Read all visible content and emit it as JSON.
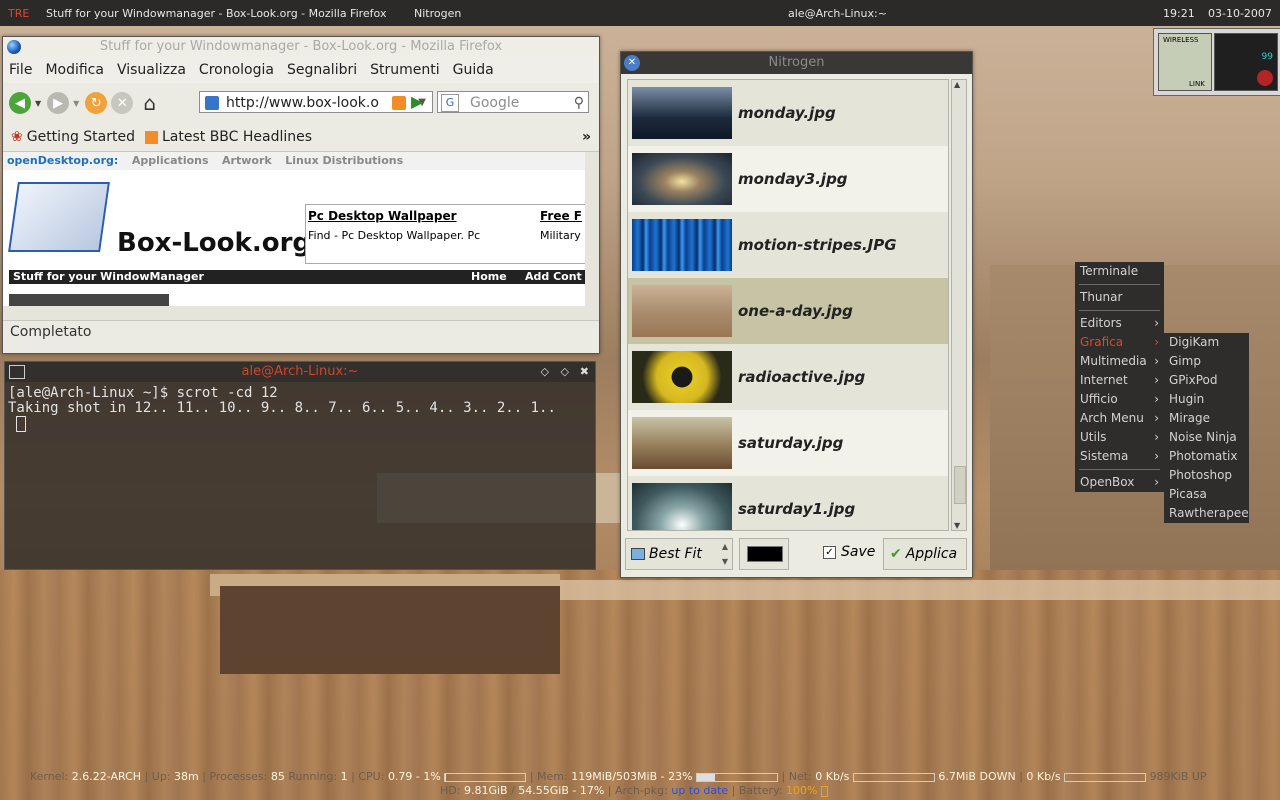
{
  "top_panel": {
    "left_label": "TRE",
    "tasks": [
      "Stuff for your Windowmanager - Box-Look.org - Mozilla Firefox",
      "Nitrogen"
    ],
    "center": "ale@Arch-Linux:~",
    "time": "19:21",
    "date": "03-10-2007"
  },
  "firefox": {
    "title": "Stuff for your Windowmanager - Box-Look.org - Mozilla Firefox",
    "menu": [
      "File",
      "Modifica",
      "Visualizza",
      "Cronologia",
      "Segnalibri",
      "Strumenti",
      "Guida"
    ],
    "url": "http://www.box-look.o",
    "search_placeholder": "Google",
    "bookmarks": [
      "Getting Started",
      "Latest BBC Headlines"
    ],
    "page": {
      "od_logo": "openDesktop.org:",
      "od_nav": [
        "Applications",
        "Artwork",
        "Linux Distributions"
      ],
      "site_name": "Box-Look.org",
      "ad_title": "Pc Desktop Wallpaper",
      "ad_text": "Find - Pc Desktop Wallpaper. Pc",
      "ad2_title": "Free F",
      "ad2_text": "Military",
      "tagline": "Stuff for your WindowManager",
      "nav_links": [
        "Home",
        "Add Cont"
      ]
    },
    "status": "Completato"
  },
  "terminal": {
    "title": "ale@Arch-Linux:~",
    "lines": [
      "[ale@Arch-Linux ~]$ scrot -cd 12",
      "Taking shot in 12.. 11.. 10.. 9.. 8.. 7.. 6.. 5.. 4.. 3.. 2.. 1.."
    ]
  },
  "nitrogen": {
    "title": "Nitrogen",
    "files": [
      "monday.jpg",
      "monday3.jpg",
      "motion-stripes.JPG",
      "one-a-day.jpg",
      "radioactive.jpg",
      "saturday.jpg",
      "saturday1.jpg"
    ],
    "selected_index": 3,
    "mode": "Best Fit",
    "save_label": "Save",
    "apply_label": "Applica",
    "bg_color": "#000000"
  },
  "openbox_menu": {
    "items": [
      {
        "label": "Terminale",
        "sub": false
      },
      {
        "label": "Thunar",
        "sub": false
      },
      {
        "label": "Editors",
        "sub": true
      },
      {
        "label": "Grafica",
        "sub": true,
        "active": true
      },
      {
        "label": "Multimedia",
        "sub": true
      },
      {
        "label": "Internet",
        "sub": true
      },
      {
        "label": "Ufficio",
        "sub": true
      },
      {
        "label": "Arch Menu",
        "sub": true
      },
      {
        "label": "Utils",
        "sub": true
      },
      {
        "label": "Sistema",
        "sub": true
      },
      {
        "label": "OpenBox",
        "sub": true
      }
    ],
    "submenu": [
      "DigiKam",
      "Gimp",
      "GPixPod",
      "Hugin",
      "Mirage",
      "Noise Ninja",
      "Photomatix",
      "Photoshop",
      "Picasa",
      "Rawtherapee"
    ],
    "active_color": "#e0462a"
  },
  "dockapp": {
    "label": "WIRELESS",
    "link": "LINK",
    "value": "99"
  },
  "conky": {
    "kernel_label": "Kernel:",
    "kernel": "2.6.22-ARCH",
    "up_label": "Up:",
    "up": "38m",
    "proc_label": "Processes:",
    "proc": "85",
    "run_label": "Running:",
    "run": "1",
    "cpu_label": "CPU:",
    "cpu": "0.79 - 1%",
    "mem_label": "Mem:",
    "mem": "119MiB/503MiB - 23%",
    "net_label": "Net:",
    "net": "0 Kb/s",
    "down": "6.7MiB DOWN",
    "net2": "0 Kb/s",
    "up_total": "989KiB UP",
    "hd_label": "HD:",
    "hd": "9.81GiB",
    "hd2": "54.55GiB - 17%",
    "pkg_label": "Arch-pkg:",
    "pkg": "up to date",
    "bat_label": "Battery:",
    "bat": "100%",
    "cpu_fraction": 0.01,
    "mem_fraction": 0.23
  }
}
